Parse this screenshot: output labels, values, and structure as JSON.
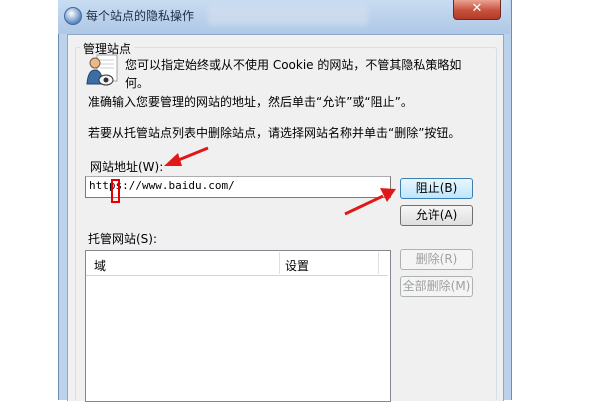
{
  "window": {
    "title": "每个站点的隐私操作",
    "close_label": "✕"
  },
  "group": {
    "label": "管理站点",
    "desc_line1": "您可以指定始终或从不使用 Cookie 的网站，不管其隐私策略如",
    "desc_line2": "何。",
    "desc_line3": "准确输入您要管理的网站的地址，然后单击“允许”或“阻止”。",
    "desc_line4": "若要从托管站点列表中删除站点，请选择网站名称并单击“删除”按钮。"
  },
  "address": {
    "label": "网站地址(W):",
    "value": "https://www.baidu.com/"
  },
  "buttons": {
    "block": "阻止(B)",
    "allow": "允许(A)",
    "remove": "删除(R)",
    "remove_all": "全部删除(M)"
  },
  "managed": {
    "label": "托管网站(S):",
    "columns": [
      "域",
      "设置"
    ]
  },
  "annotation": {
    "arrow_color": "#e01818",
    "highlight_color": "#e30000"
  }
}
